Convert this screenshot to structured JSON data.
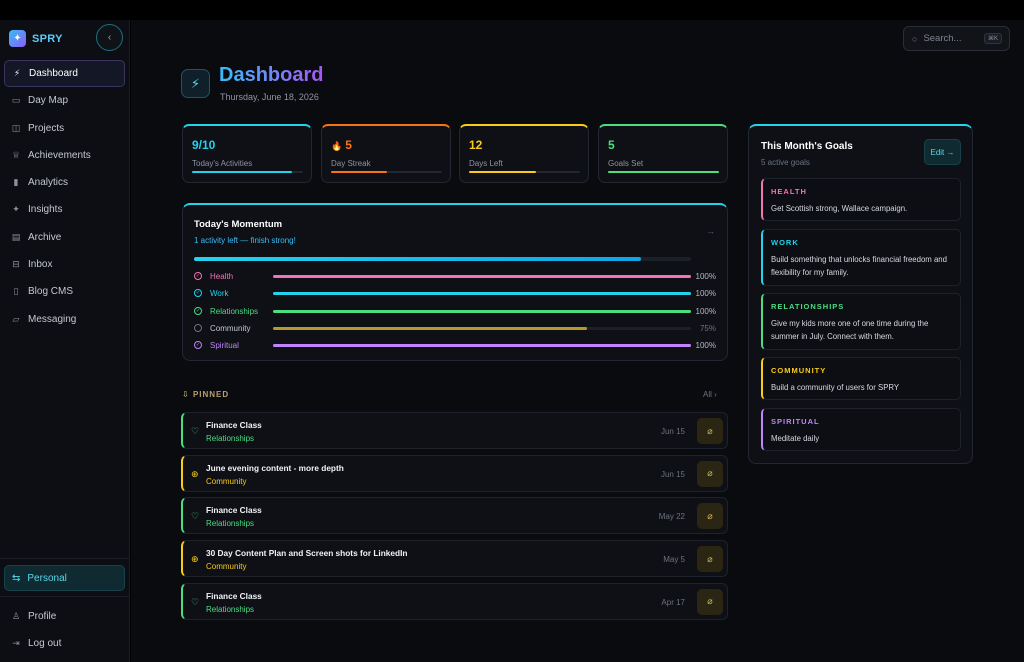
{
  "app": {
    "name": "SPRY",
    "collapse_icon": "‹"
  },
  "sidebar": {
    "items": [
      {
        "label": "Dashboard",
        "icon": "⚡",
        "active": true
      },
      {
        "label": "Day Map",
        "icon": "▭"
      },
      {
        "label": "Projects",
        "icon": "◫"
      },
      {
        "label": "Achievements",
        "icon": "♕"
      },
      {
        "label": "Analytics",
        "icon": "▮"
      },
      {
        "label": "Insights",
        "icon": "✦"
      },
      {
        "label": "Archive",
        "icon": "▤"
      },
      {
        "label": "Inbox",
        "icon": "⊟"
      },
      {
        "label": "Blog CMS",
        "icon": "▯"
      },
      {
        "label": "Messaging",
        "icon": "▱"
      }
    ],
    "workspace": {
      "label": "Personal",
      "icon": "⇆"
    },
    "bottom": [
      {
        "label": "Profile",
        "icon": "♙"
      },
      {
        "label": "Log out",
        "icon": "⇥"
      }
    ]
  },
  "header": {
    "search_placeholder": "Search...",
    "search_shortcut": "⌘K",
    "title": "Dashboard",
    "date": "Thursday, June 18, 2026"
  },
  "stats": [
    {
      "value": "9/10",
      "label": "Today's Activities",
      "color": "#22d3ee",
      "progress": 0.9
    },
    {
      "value": "5",
      "icon": "🔥",
      "label": "Day Streak",
      "color": "#f97316",
      "progress": 0.5
    },
    {
      "value": "12",
      "label": "Days Left",
      "color": "#facc15",
      "progress": 0.6
    },
    {
      "value": "5",
      "label": "Goals Set",
      "color": "#4ade80",
      "progress": 1.0
    }
  ],
  "momentum": {
    "title": "Today's Momentum",
    "subtitle": "1 activity left — finish strong!",
    "arrow": "→",
    "progress": 0.9,
    "categories": [
      {
        "name": "Health",
        "percent": "100%",
        "progress": 1.0,
        "color": "#f472b6",
        "done": true
      },
      {
        "name": "Work",
        "percent": "100%",
        "progress": 1.0,
        "color": "#22d3ee",
        "done": true
      },
      {
        "name": "Relationships",
        "percent": "100%",
        "progress": 1.0,
        "color": "#4ade80",
        "done": true
      },
      {
        "name": "Community",
        "percent": "75%",
        "progress": 0.75,
        "color": "#b79a2c",
        "done": false
      },
      {
        "name": "Spiritual",
        "percent": "100%",
        "progress": 1.0,
        "color": "#c084fc",
        "done": true
      }
    ]
  },
  "pinned": {
    "title": "PINNED",
    "all_label": "All ›",
    "items": [
      {
        "title": "Finance Class",
        "category": "Relationships",
        "date": "Jun 15",
        "color": "#4ade80",
        "icon": "♡"
      },
      {
        "title": "June evening content - more depth",
        "category": "Community",
        "date": "Jun 15",
        "color": "#facc15",
        "icon": "⊕"
      },
      {
        "title": "Finance Class",
        "category": "Relationships",
        "date": "May 22",
        "color": "#4ade80",
        "icon": "♡"
      },
      {
        "title": "30 Day Content Plan and Screen shots for LinkedIn",
        "category": "Community",
        "date": "May 5",
        "color": "#facc15",
        "icon": "⊕"
      },
      {
        "title": "Finance Class",
        "category": "Relationships",
        "date": "Apr 17",
        "color": "#4ade80",
        "icon": "♡"
      }
    ]
  },
  "goals": {
    "title": "This Month's Goals",
    "subtitle": "5 active goals",
    "edit_label": "Edit →",
    "items": [
      {
        "tag": "HEALTH",
        "text": "Get Scottish strong, Wallace campaign.",
        "color": "#f472b6"
      },
      {
        "tag": "WORK",
        "text": "Build something that unlocks financial freedom and flexibility for my family.",
        "color": "#22d3ee"
      },
      {
        "tag": "RELATIONSHIPS",
        "text": "Give my kids more one of one time during the summer in July. Connect with them.",
        "color": "#4ade80"
      },
      {
        "tag": "COMMUNITY",
        "text": "Build a community of users for SPRY",
        "color": "#facc15"
      },
      {
        "tag": "SPIRITUAL",
        "text": "Meditate daily",
        "color": "#c084fc"
      }
    ]
  }
}
